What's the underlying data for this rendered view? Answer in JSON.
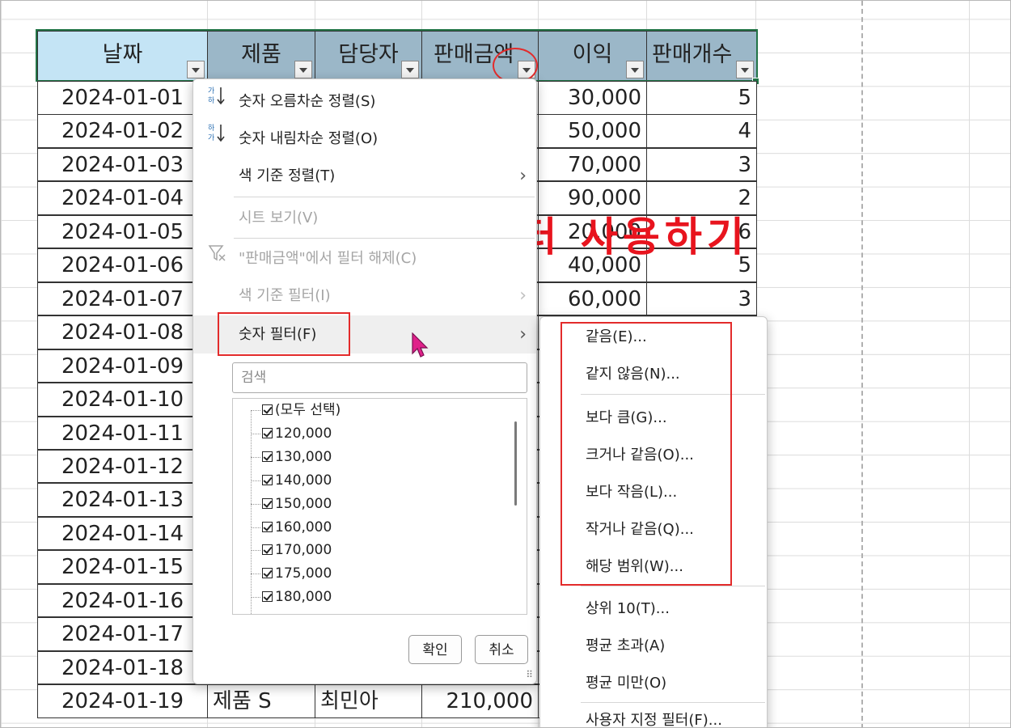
{
  "table": {
    "headers": [
      "날짜",
      "제품",
      "담당자",
      "판매금액",
      "이익",
      "판매개수"
    ],
    "rows": [
      {
        "date": "2024-01-01",
        "profit": "30,000",
        "qty": "5"
      },
      {
        "date": "2024-01-02",
        "profit": "50,000",
        "qty": "4"
      },
      {
        "date": "2024-01-03",
        "profit": "70,000",
        "qty": "3"
      },
      {
        "date": "2024-01-04",
        "profit": "90,000",
        "qty": "2"
      },
      {
        "date": "2024-01-05",
        "profit": "20,000",
        "qty": "6"
      },
      {
        "date": "2024-01-06",
        "profit": "40,000",
        "qty": "5"
      },
      {
        "date": "2024-01-07",
        "profit": "60,000",
        "qty": "3"
      },
      {
        "date": "2024-01-08"
      },
      {
        "date": "2024-01-09"
      },
      {
        "date": "2024-01-10"
      },
      {
        "date": "2024-01-11"
      },
      {
        "date": "2024-01-12"
      },
      {
        "date": "2024-01-13"
      },
      {
        "date": "2024-01-14"
      },
      {
        "date": "2024-01-15"
      },
      {
        "date": "2024-01-16"
      },
      {
        "date": "2024-01-17"
      },
      {
        "date": "2024-01-18"
      },
      {
        "date": "2024-01-19",
        "product": "제품 S",
        "manager": "최민아",
        "amount": "210,000"
      }
    ]
  },
  "overlay": {
    "title": "숫자 필터 사용하기"
  },
  "filter_menu": {
    "sort_asc": "숫자 오름차순 정렬(S)",
    "sort_desc": "숫자 내림차순 정렬(O)",
    "sort_color": "색 기준 정렬(T)",
    "sheet_view": "시트 보기(V)",
    "clear_filter": "\"판매금액\"에서 필터 해제(C)",
    "filter_color": "색 기준 필터(I)",
    "number_filter": "숫자 필터(F)",
    "search_placeholder": "검색",
    "checklist": [
      "(모두 선택)",
      "120,000",
      "130,000",
      "140,000",
      "150,000",
      "160,000",
      "170,000",
      "175,000",
      "180,000"
    ],
    "ok": "확인",
    "cancel": "취소"
  },
  "number_submenu": {
    "items": [
      "같음(E)...",
      "같지 않음(N)...",
      "보다 큼(G)...",
      "크거나 같음(O)...",
      "보다 작음(L)...",
      "작거나 같음(Q)...",
      "해당 범위(W)...",
      "상위 10(T)...",
      "평균 초과(A)",
      "평균 미만(O)",
      "사용자 지정 필터(F)..."
    ]
  },
  "colors": {
    "header_selected": "#c4e4f5",
    "header": "#9bb7c8",
    "annotation_red": "#e32b2b",
    "cursor": "#e0218a"
  },
  "icons": [
    "sort-ascending-icon",
    "sort-descending-icon",
    "clear-filter-icon",
    "chevron-right-icon",
    "checkbox-checked-icon",
    "dropdown-arrow-icon",
    "pointer-cursor-icon"
  ]
}
